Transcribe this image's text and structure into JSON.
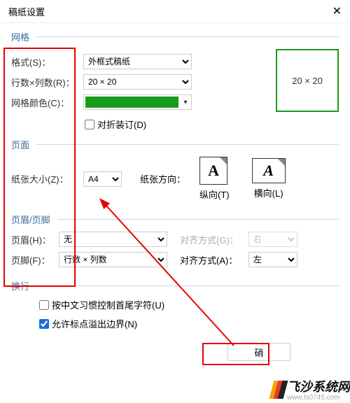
{
  "window": {
    "title": "稿纸设置",
    "close_icon": "✕"
  },
  "grid": {
    "legend": "网格",
    "format_label": "格式(S)：",
    "format_value": "外框式稿纸",
    "rows_cols_label": "行数×列数(R)：",
    "rows_cols_value": "20 × 20",
    "color_label": "网格颜色(C)：",
    "preview_text": "20 × 20",
    "fold_bind": "对折装订(D)"
  },
  "page": {
    "legend": "页面",
    "paper_size_label": "纸张大小(Z)：",
    "paper_size_value": "A4",
    "direction_label": "纸张方向：",
    "portrait_label": "纵向(T)",
    "landscape_label": "横向(L)",
    "glyph": "A"
  },
  "header_footer": {
    "legend": "页眉/页脚",
    "header_label": "页眉(H)：",
    "header_value": "无",
    "align_g_label": "对齐方式(G)：",
    "align_g_value": "右",
    "footer_label": "页脚(F)：",
    "footer_value": "行数 × 列数",
    "align_a_label": "对齐方式(A)：",
    "align_a_value": "左"
  },
  "wrap": {
    "legend": "换行",
    "cjk_control": "按中文习惯控制首尾字符(U)",
    "punct_overflow": "允许标点溢出边界(N)"
  },
  "button": {
    "ok_fragment": "硝"
  },
  "watermark": {
    "text": "飞沙系统网",
    "url": "www.fs0745.com"
  },
  "colors": {
    "green": "#1a9a1a",
    "red": "#e60000"
  }
}
